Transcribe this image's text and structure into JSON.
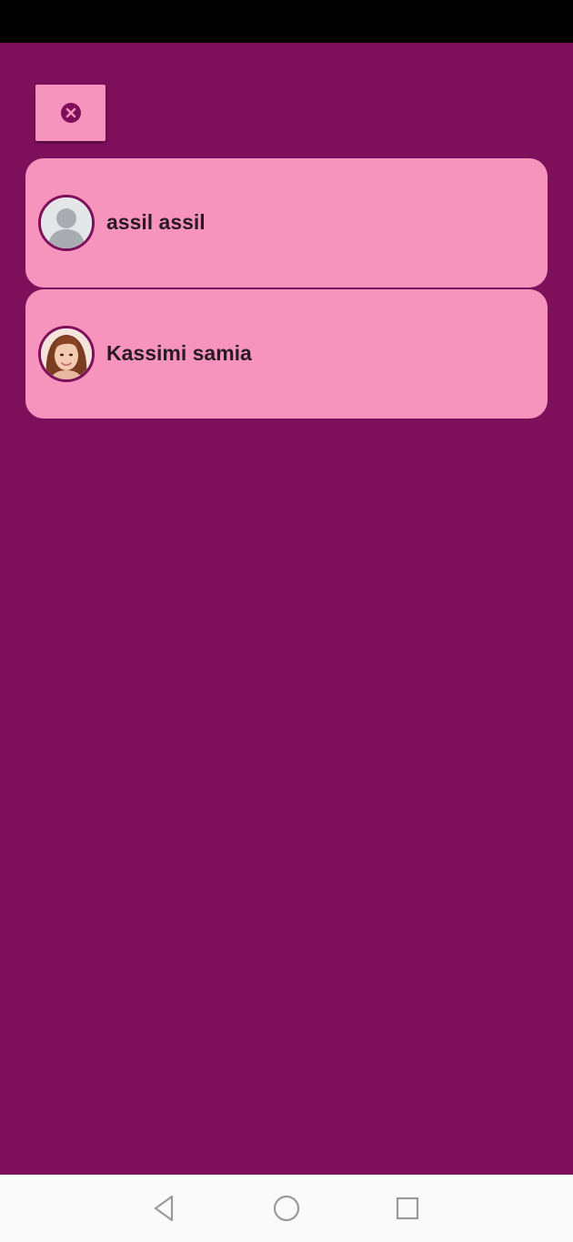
{
  "theme": {
    "background": "#7d0f5b",
    "card": "#f794bd",
    "status_bar": "#000000",
    "nav_bar": "#fafafa"
  },
  "close_button": {
    "icon": "close-circle-icon"
  },
  "contacts": [
    {
      "name": "assil assil",
      "avatar": "default-person-avatar"
    },
    {
      "name": "Kassimi samia",
      "avatar": "profile-photo"
    }
  ],
  "system_nav": {
    "back_icon": "back-triangle-icon",
    "home_icon": "home-circle-icon",
    "recent_icon": "recent-apps-square-icon"
  }
}
